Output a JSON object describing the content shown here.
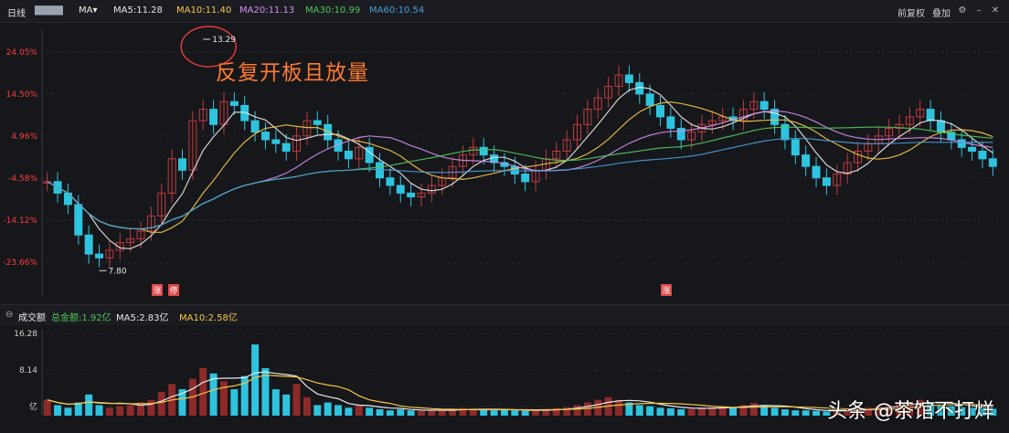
{
  "header": {
    "period": "日线",
    "ma_selector": "MA",
    "ma_items": [
      {
        "label": "MA5:11.28",
        "color": "#e8e8e8"
      },
      {
        "label": "MA10:11.40",
        "color": "#f5c542"
      },
      {
        "label": "MA20:11.13",
        "color": "#d48cf0"
      },
      {
        "label": "MA30:10.99",
        "color": "#4fc65b"
      },
      {
        "label": "MA60:10.54",
        "color": "#4a9bd8"
      }
    ],
    "right_buttons": [
      "前复权",
      "叠加"
    ]
  },
  "annotation": "反复开板且放量",
  "markers": {
    "high": "13.29",
    "low": "7.80"
  },
  "event_flags": [
    {
      "label": "涨",
      "color": "#e04848"
    },
    {
      "label": "停",
      "color": "#e04848"
    },
    {
      "label": "涨",
      "color": "#e04848"
    }
  ],
  "volume_header": {
    "title": "成交额",
    "items": [
      {
        "label": "总金额:1.92亿",
        "color": "#4fc65b"
      },
      {
        "label": "MA5:2.83亿",
        "color": "#e8e8e8"
      },
      {
        "label": "MA10:2.58亿",
        "color": "#f5c542"
      }
    ]
  },
  "watermark": "头条 @茶馆不打烊",
  "colors": {
    "up": "#c23b3b",
    "down": "#2ec4e0",
    "background": "#16171b"
  },
  "chart_data": [
    {
      "type": "candlestick",
      "y_axis_ticks": [
        "24.05%",
        "14.50%",
        "4.96%",
        "-4.58%",
        "-14.12%",
        "-23.66%"
      ],
      "ylim": [
        6.9,
        13.9
      ],
      "grid": true,
      "ma_lines": [
        "MA5",
        "MA10",
        "MA20",
        "MA30",
        "MA60"
      ],
      "series": [
        {
          "name": "close",
          "values": [
            9.9,
            9.6,
            9.3,
            8.5,
            8.0,
            7.9,
            8.1,
            8.3,
            8.4,
            8.6,
            9.0,
            9.6,
            10.5,
            10.2,
            11.5,
            11.8,
            11.4,
            12.0,
            11.9,
            11.5,
            11.2,
            11.0,
            10.9,
            10.7,
            11.1,
            11.5,
            11.4,
            11.0,
            10.7,
            10.5,
            10.8,
            10.4,
            10.0,
            9.8,
            9.6,
            9.5,
            9.6,
            9.8,
            10.0,
            10.3,
            10.6,
            10.8,
            10.6,
            10.4,
            10.3,
            10.1,
            9.9,
            10.2,
            10.5,
            10.7,
            11.0,
            11.4,
            11.8,
            12.1,
            12.4,
            12.7,
            12.5,
            12.2,
            11.9,
            11.6,
            11.3,
            11.0,
            11.2,
            11.4,
            11.5,
            11.6,
            11.5,
            11.8,
            12.0,
            11.8,
            11.4,
            11.0,
            10.6,
            10.3,
            10.0,
            9.8,
            10.1,
            10.4,
            10.7,
            10.9,
            11.1,
            11.3,
            11.4,
            11.6,
            11.8,
            11.5,
            11.2,
            11.0,
            10.8,
            10.7,
            10.5,
            10.3
          ]
        }
      ]
    },
    {
      "type": "bar",
      "title": "成交额",
      "y_axis_ticks": [
        "16.28",
        "8.14",
        "亿"
      ],
      "ylim": [
        0,
        16.28
      ],
      "series": [
        {
          "name": "volume",
          "values": [
            3.0,
            2.0,
            1.5,
            2.5,
            4.0,
            2.0,
            1.5,
            1.8,
            2.0,
            2.5,
            3.0,
            4.5,
            6.0,
            5.0,
            7.0,
            9.0,
            8.0,
            6.5,
            5.0,
            7.5,
            13.5,
            9.0,
            5.0,
            4.0,
            6.0,
            3.5,
            2.0,
            2.5,
            2.0,
            1.5,
            2.0,
            1.5,
            1.2,
            1.0,
            1.2,
            1.0,
            0.9,
            1.1,
            1.0,
            1.2,
            1.4,
            1.3,
            1.2,
            1.0,
            1.1,
            1.0,
            0.9,
            1.0,
            1.2,
            1.4,
            1.6,
            2.0,
            2.5,
            3.0,
            3.5,
            3.0,
            2.5,
            2.0,
            1.8,
            1.5,
            1.4,
            1.2,
            1.3,
            1.5,
            1.6,
            1.8,
            1.5,
            2.0,
            2.4,
            2.0,
            1.5,
            1.2,
            1.0,
            1.0,
            0.9,
            0.8,
            0.9,
            1.1,
            1.3,
            1.5,
            1.8,
            2.0,
            2.3,
            2.6,
            3.0,
            2.5,
            2.0,
            1.8,
            1.6,
            1.5,
            1.4,
            1.3
          ]
        }
      ]
    }
  ]
}
